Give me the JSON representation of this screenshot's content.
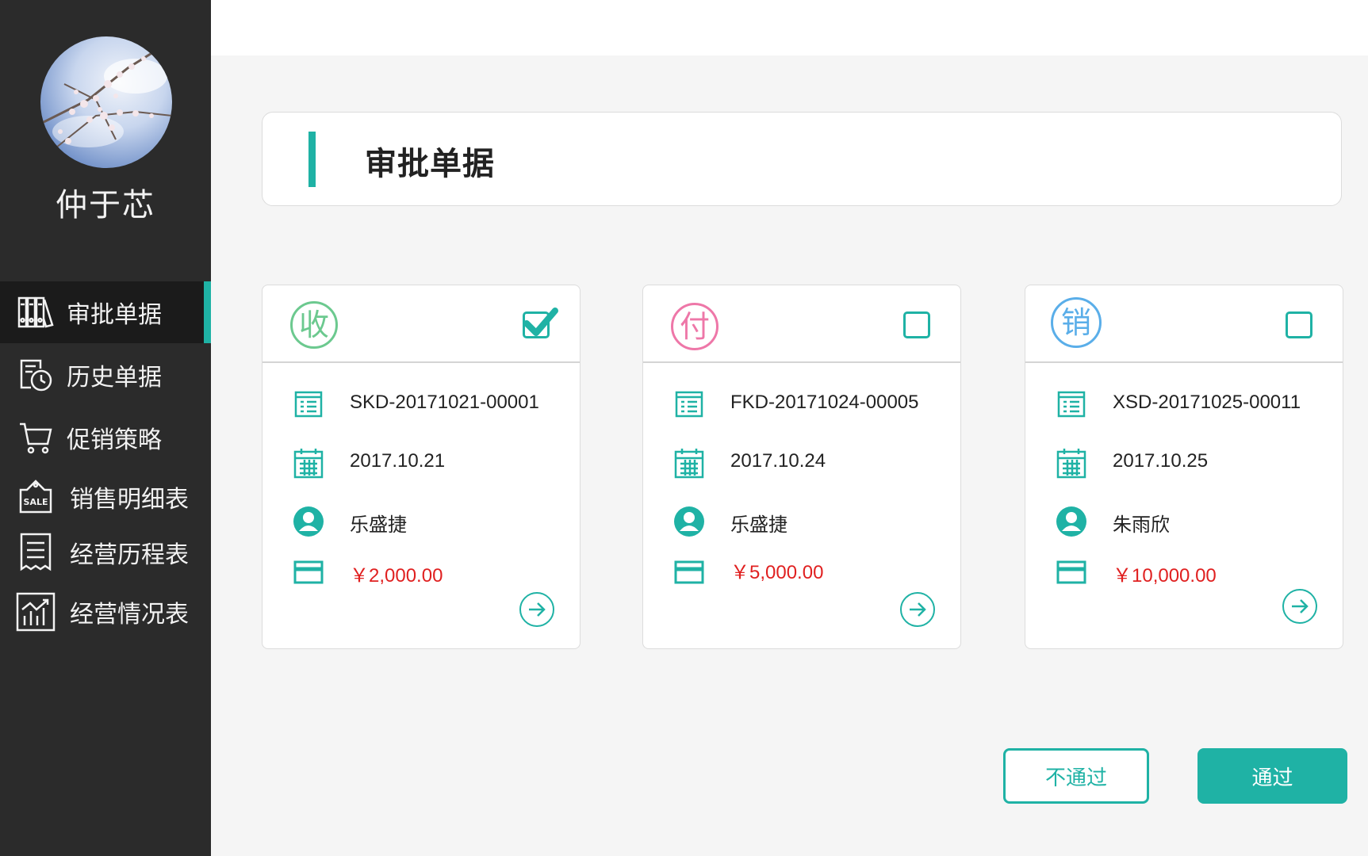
{
  "user": {
    "name": "仲于芯"
  },
  "nav": [
    {
      "label": "审批单据",
      "icon": "binders-icon",
      "active": true
    },
    {
      "label": "历史单据",
      "icon": "history-document-icon",
      "active": false
    },
    {
      "label": "促销策略",
      "icon": "shopping-cart-icon",
      "active": false
    },
    {
      "label": "销售明细表",
      "icon": "sale-tag-icon",
      "active": false
    },
    {
      "label": "经营历程表",
      "icon": "receipt-list-icon",
      "active": false
    },
    {
      "label": "经营情况表",
      "icon": "chart-trend-icon",
      "active": false
    }
  ],
  "header": {
    "title": "审批单据"
  },
  "documents": [
    {
      "type_char": "收",
      "type_color": "#6cc98f",
      "checked": true,
      "doc_id": "SKD-20171021-00001",
      "date": "2017.10.21",
      "person": "乐盛捷",
      "amount": "￥2,000.00"
    },
    {
      "type_char": "付",
      "type_color": "#ee77a8",
      "checked": false,
      "doc_id": "FKD-20171024-00005",
      "date": "2017.10.24",
      "person": "乐盛捷",
      "amount": "￥5,000.00"
    },
    {
      "type_char": "销",
      "type_color": "#5aaee9",
      "checked": false,
      "doc_id": "XSD-20171025-00011",
      "date": "2017.10.25",
      "person": "朱雨欣",
      "amount": "￥10,000.00"
    }
  ],
  "actions": {
    "reject_label": "不通过",
    "approve_label": "通过"
  },
  "colors": {
    "accent": "#1fb2a5",
    "sidebar": "#2b2b2b",
    "amount": "#e02020"
  }
}
